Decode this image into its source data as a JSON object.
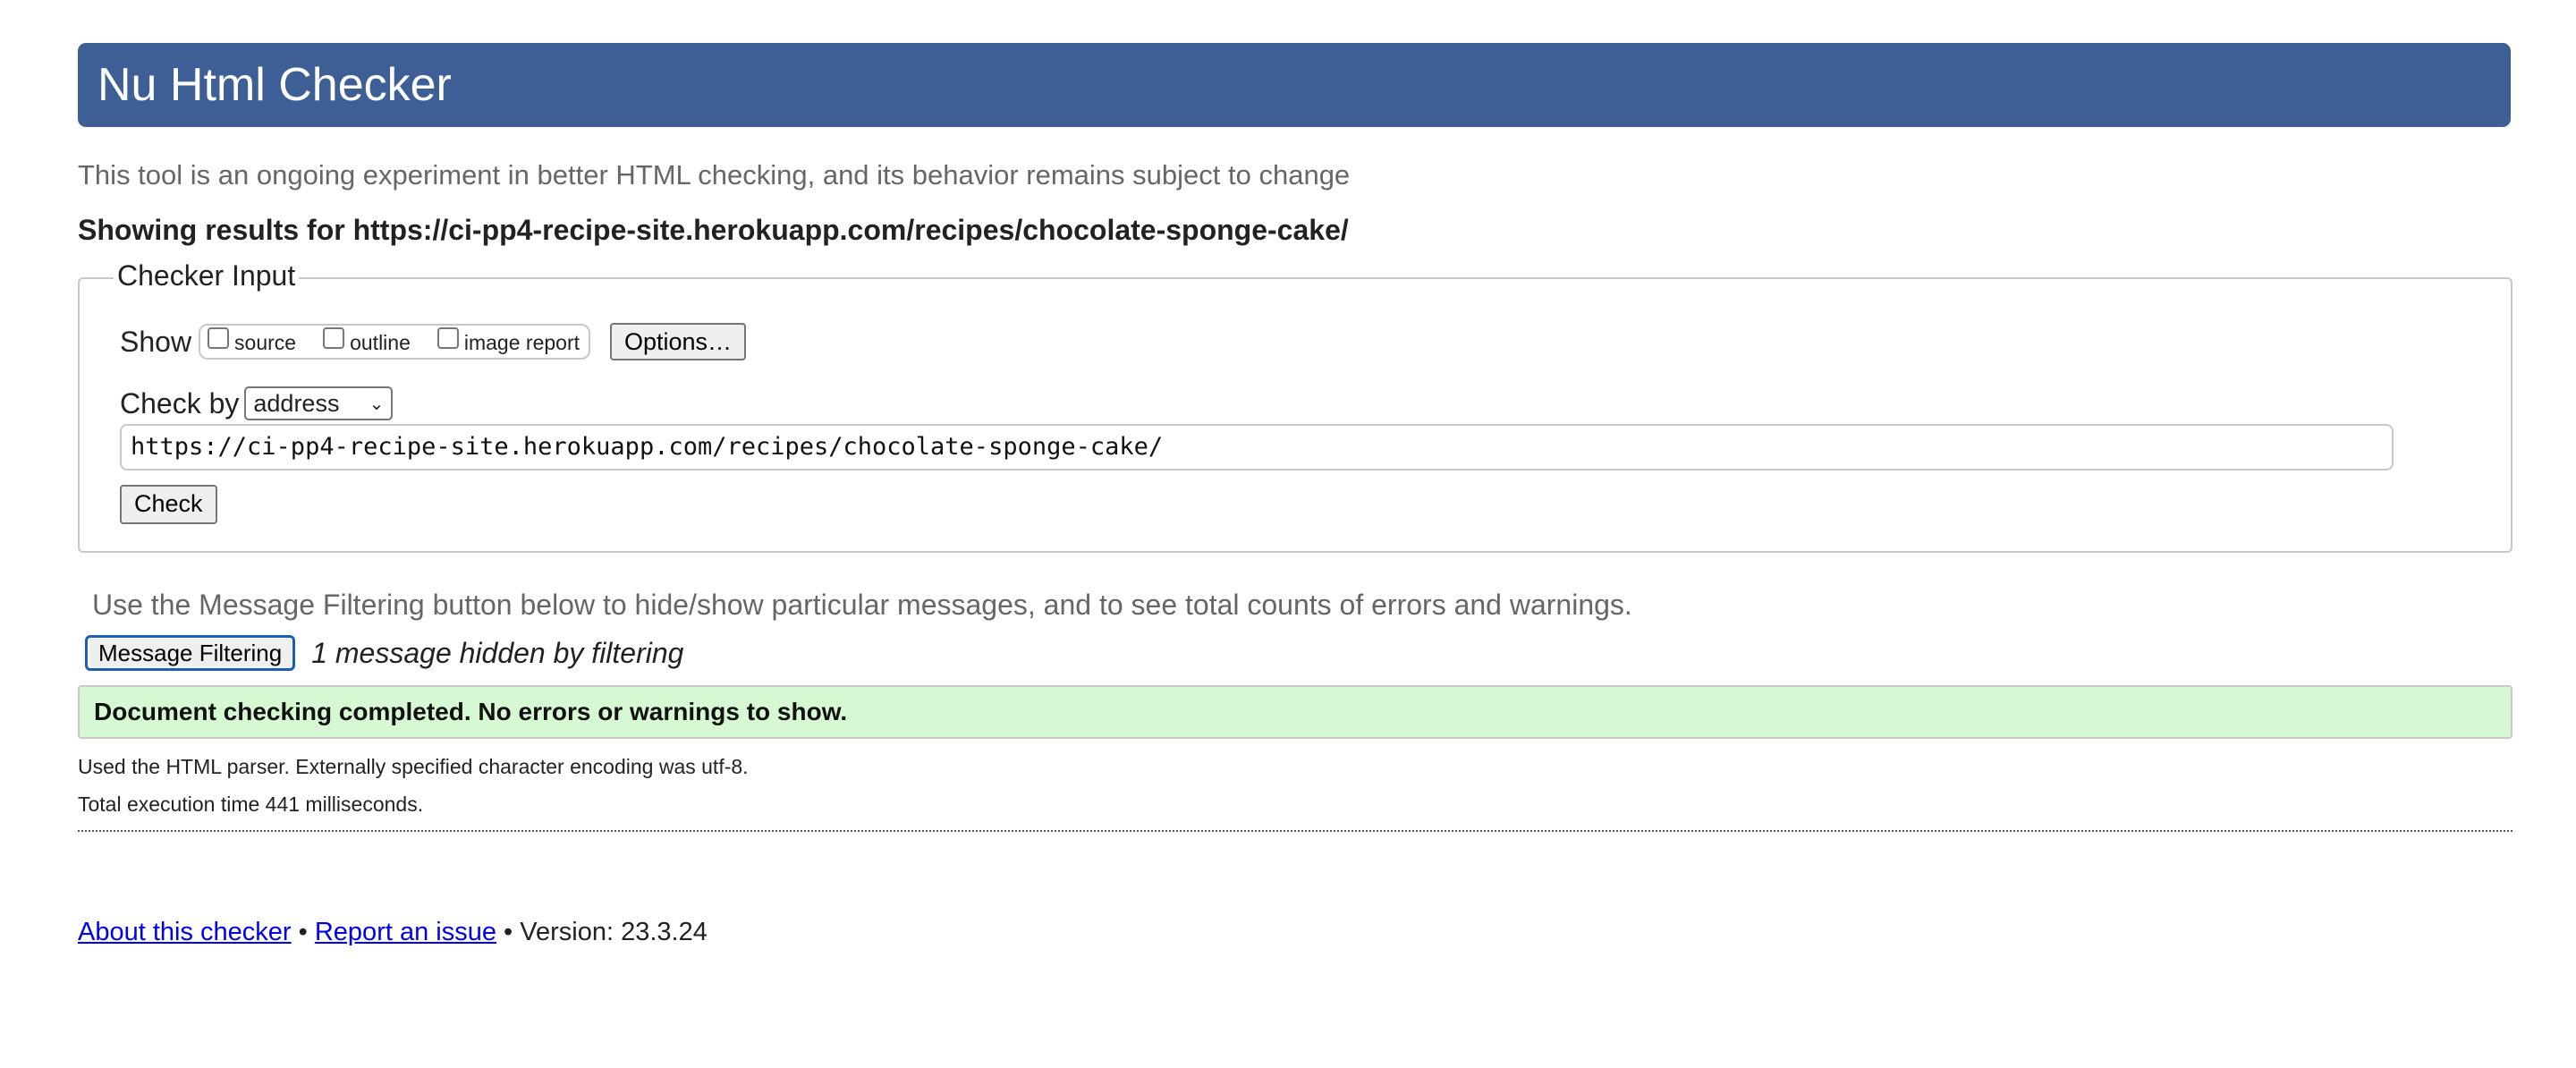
{
  "header": {
    "title": "Nu Html Checker",
    "subtitle": "This tool is an ongoing experiment in better HTML checking, and its behavior remains subject to change",
    "showing_results": "Showing results for https://ci-pp4-recipe-site.herokuapp.com/recipes/chocolate-sponge-cake/"
  },
  "checker_input": {
    "legend": "Checker Input",
    "show_label": "Show",
    "show_options": [
      {
        "label": "source",
        "checked": false
      },
      {
        "label": "outline",
        "checked": false
      },
      {
        "label": "image report",
        "checked": false
      }
    ],
    "options_button": "Options…",
    "check_by_label": "Check by",
    "check_by_selected": "address",
    "url_value": "https://ci-pp4-recipe-site.herokuapp.com/recipes/chocolate-sponge-cake/",
    "check_button": "Check"
  },
  "filtering": {
    "hint": "Use the Message Filtering button below to hide/show particular messages, and to see total counts of errors and warnings.",
    "button_label": "Message Filtering",
    "hidden_message": "1 message hidden by filtering"
  },
  "results": {
    "success_message": "Document checking completed. No errors or warnings to show.",
    "parser_info": "Used the HTML parser. Externally specified character encoding was utf-8.",
    "execution_time": "Total execution time 441 milliseconds."
  },
  "footer": {
    "about_link": "About this checker",
    "separator": "•",
    "report_link": "Report an issue",
    "version": "Version: 23.3.24"
  },
  "colors": {
    "title_bar": "#3e5f95",
    "success_bg": "#d6f9d3",
    "link": "#0000ee",
    "focus_ring": "#1a5fb4"
  }
}
